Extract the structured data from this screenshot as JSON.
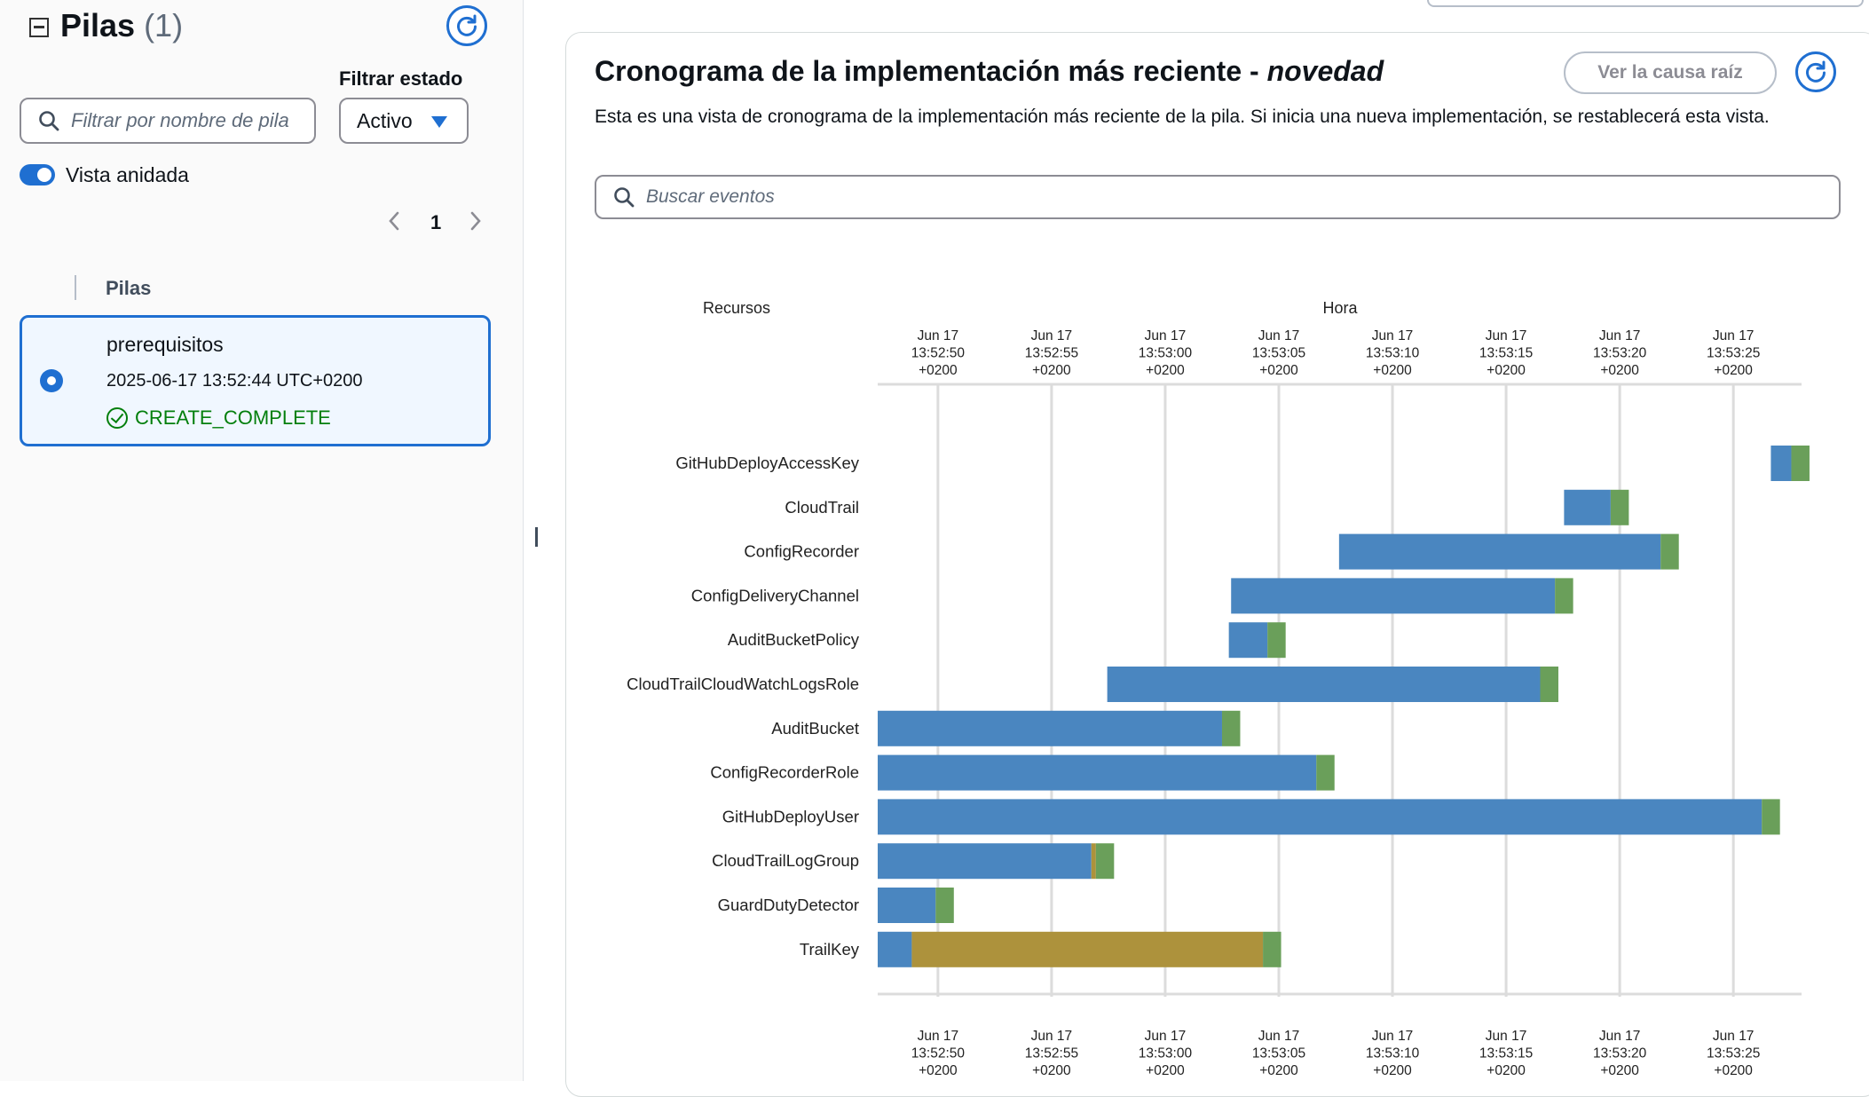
{
  "left_panel": {
    "title": "Pilas",
    "count": "(1)",
    "filter_status_label": "Filtrar estado",
    "filter_placeholder": "Filtrar por nombre de pila",
    "status_select_value": "Activo",
    "nested_view_label": "Vista anidada",
    "nested_view_enabled": true,
    "page": "1",
    "column_header": "Pilas",
    "stacks": [
      {
        "name": "prerequisitos",
        "created": "2025-06-17 13:52:44 UTC+0200",
        "status": "CREATE_COMPLETE",
        "selected": true
      }
    ]
  },
  "main": {
    "title_prefix": "Cronograma de la implementación más reciente - ",
    "title_stack": "novedad",
    "root_cause_button": "Ver la causa raíz",
    "description": "Esta es una vista de cronograma de la implementación más reciente de la pila. Si inicia una nueva implementación, se restablecerá esta vista.",
    "search_placeholder": "Buscar eventos"
  },
  "chart_data": {
    "type": "gantt",
    "resources_label": "Recursos",
    "time_label": "Hora",
    "ticks": [
      {
        "label": [
          "Jun 17",
          "13:52:50",
          "+0200"
        ],
        "t": 0
      },
      {
        "label": [
          "Jun 17",
          "13:52:55",
          "+0200"
        ],
        "t": 5
      },
      {
        "label": [
          "Jun 17",
          "13:53:00",
          "+0200"
        ],
        "t": 10
      },
      {
        "label": [
          "Jun 17",
          "13:53:05",
          "+0200"
        ],
        "t": 15
      },
      {
        "label": [
          "Jun 17",
          "13:53:10",
          "+0200"
        ],
        "t": 20
      },
      {
        "label": [
          "Jun 17",
          "13:53:15",
          "+0200"
        ],
        "t": 25
      },
      {
        "label": [
          "Jun 17",
          "13:53:20",
          "+0200"
        ],
        "t": 30
      },
      {
        "label": [
          "Jun 17",
          "13:53:25",
          "+0200"
        ],
        "t": 35
      }
    ],
    "x_range": [
      -2.65,
      38.0
    ],
    "colors": {
      "in_progress": "#4a86c0",
      "complete": "#6a9f5a",
      "waiting": "#ad923c"
    },
    "resources": [
      {
        "name": "GitHubDeployAccessKey",
        "segments": [
          [
            36.65,
            37.55,
            "in_progress"
          ],
          [
            37.55,
            38.35,
            "complete"
          ]
        ]
      },
      {
        "name": "CloudTrail",
        "segments": [
          [
            27.55,
            29.6,
            "in_progress"
          ],
          [
            29.6,
            30.4,
            "complete"
          ]
        ]
      },
      {
        "name": "ConfigRecorder",
        "segments": [
          [
            17.65,
            31.8,
            "in_progress"
          ],
          [
            31.8,
            32.6,
            "complete"
          ]
        ]
      },
      {
        "name": "ConfigDeliveryChannel",
        "segments": [
          [
            12.9,
            27.15,
            "in_progress"
          ],
          [
            27.15,
            27.95,
            "complete"
          ]
        ]
      },
      {
        "name": "AuditBucketPolicy",
        "segments": [
          [
            12.8,
            14.5,
            "in_progress"
          ],
          [
            14.5,
            15.3,
            "complete"
          ]
        ]
      },
      {
        "name": "CloudTrailCloudWatchLogsRole",
        "segments": [
          [
            7.45,
            26.5,
            "in_progress"
          ],
          [
            26.5,
            27.3,
            "complete"
          ]
        ]
      },
      {
        "name": "AuditBucket",
        "segments": [
          [
            -2.65,
            12.5,
            "in_progress"
          ],
          [
            12.5,
            13.3,
            "complete"
          ]
        ]
      },
      {
        "name": "ConfigRecorderRole",
        "segments": [
          [
            -2.65,
            16.65,
            "in_progress"
          ],
          [
            16.65,
            17.45,
            "complete"
          ]
        ]
      },
      {
        "name": "GitHubDeployUser",
        "segments": [
          [
            -2.65,
            36.25,
            "in_progress"
          ],
          [
            36.25,
            37.05,
            "complete"
          ]
        ]
      },
      {
        "name": "CloudTrailLogGroup",
        "segments": [
          [
            -2.65,
            6.75,
            "in_progress"
          ],
          [
            6.75,
            6.95,
            "waiting"
          ],
          [
            6.95,
            7.75,
            "complete"
          ]
        ]
      },
      {
        "name": "GuardDutyDetector",
        "segments": [
          [
            -2.65,
            -0.1,
            "in_progress"
          ],
          [
            -0.1,
            0.7,
            "complete"
          ]
        ]
      },
      {
        "name": "TrailKey",
        "segments": [
          [
            -2.65,
            -1.15,
            "in_progress"
          ],
          [
            -1.15,
            14.3,
            "waiting"
          ],
          [
            14.3,
            15.1,
            "complete"
          ]
        ]
      }
    ]
  }
}
